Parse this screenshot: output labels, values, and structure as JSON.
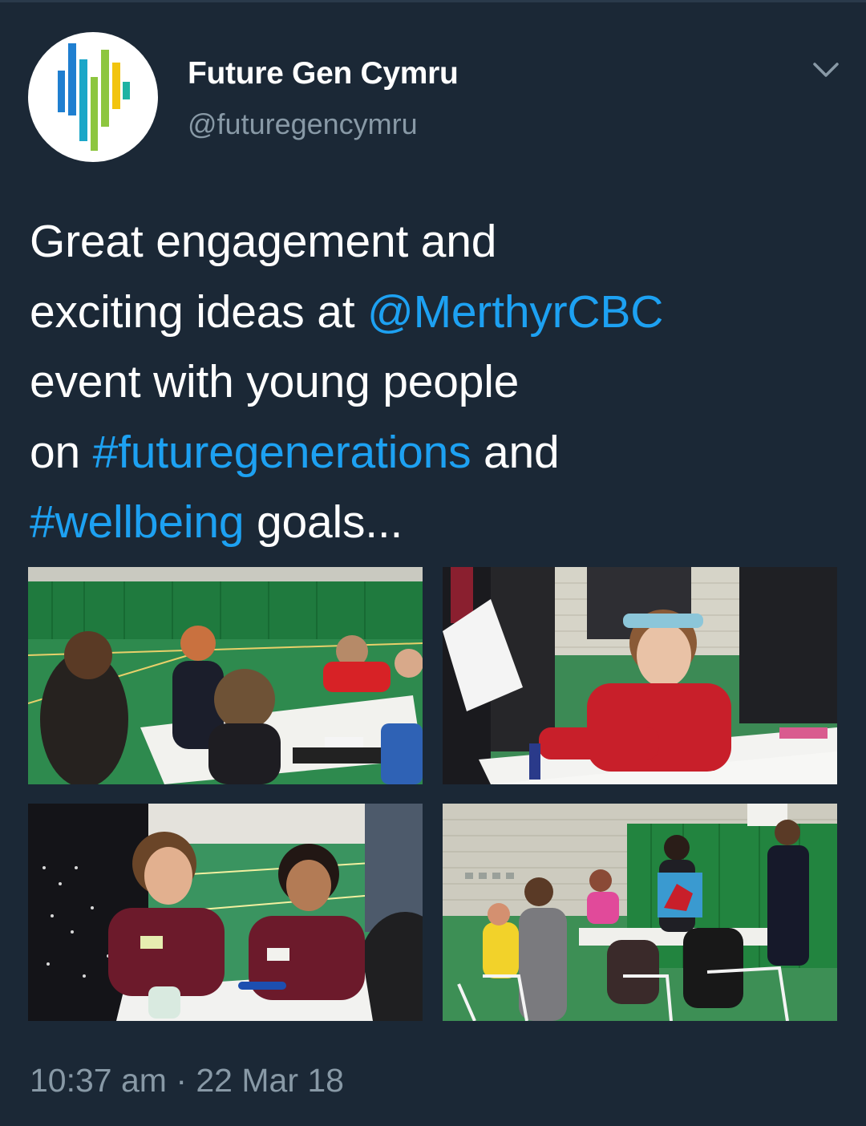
{
  "tweet": {
    "author": {
      "display_name": "Future Gen Cymru",
      "handle": "@futuregencymru",
      "avatar_icon": "bars-logo-icon"
    },
    "menu_icon": "chevron-down-icon",
    "text": {
      "line1": "Great engagement and",
      "line2_prefix": "exciting ideas at ",
      "mention": "@MerthyrCBC",
      "line3": "event with young people",
      "line4_prefix": "on ",
      "hashtag1": "#futuregenerations",
      "line4_suffix": " and",
      "hashtag2": "#wellbeing",
      "line5_suffix": " goals..."
    },
    "media": [
      {
        "alt": "Young people and an adult discussing around a table in a sports hall"
      },
      {
        "alt": "Girl with headband drawing on paper at a table"
      },
      {
        "alt": "Two school girls in maroon uniforms talking at a table"
      },
      {
        "alt": "Group presenting a Welsh dragon poster in a sports hall"
      }
    ],
    "timestamp": "10:37 am · 22 Mar 18"
  },
  "colors": {
    "background": "#1b2836",
    "text": "#ffffff",
    "secondary_text": "#8899a6",
    "link": "#1da1f2"
  }
}
